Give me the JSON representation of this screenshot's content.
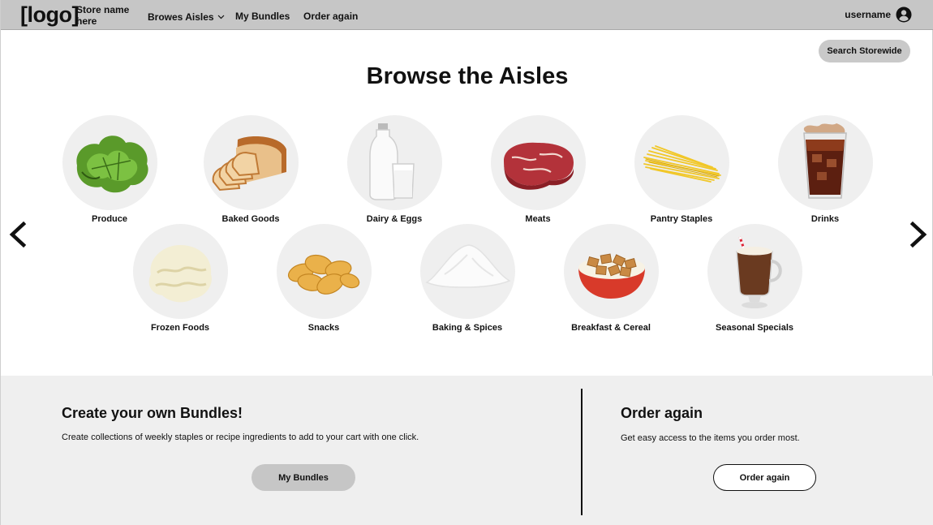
{
  "header": {
    "logo": "[logo]",
    "store_name": "Store name here",
    "nav": [
      {
        "label": "Browes Aisles"
      },
      {
        "label": "My Bundles"
      },
      {
        "label": "Order again"
      }
    ],
    "username": "username"
  },
  "search_button": "Search Storewide",
  "title": "Browse the Aisles",
  "aisles": [
    {
      "label": "Produce",
      "icon": "lettuce-icon"
    },
    {
      "label": "Baked Goods",
      "icon": "bread-icon"
    },
    {
      "label": "Dairy & Eggs",
      "icon": "milk-icon"
    },
    {
      "label": "Meats",
      "icon": "steak-icon"
    },
    {
      "label": "Pantry Staples",
      "icon": "pasta-icon"
    },
    {
      "label": "Drinks",
      "icon": "cola-icon"
    },
    {
      "label": "Frozen Foods",
      "icon": "ice-cream-icon"
    },
    {
      "label": "Snacks",
      "icon": "chips-icon"
    },
    {
      "label": "Baking & Spices",
      "icon": "flour-icon"
    },
    {
      "label": "Breakfast & Cereal",
      "icon": "cereal-icon"
    },
    {
      "label": "Seasonal Specials",
      "icon": "hot-cocoa-icon"
    }
  ],
  "bundles": {
    "title": "Create your own Bundles!",
    "text": "Create collections of weekly staples or recipe ingredients to add to your cart with one click.",
    "button": "My Bundles"
  },
  "order_again": {
    "title": "Order again",
    "text": "Get easy access to the items you order most.",
    "button": "Order again"
  },
  "colors": {
    "header_bg": "#c6c6c6",
    "panel_bg": "#efefef",
    "circle_bg": "#efefef"
  }
}
